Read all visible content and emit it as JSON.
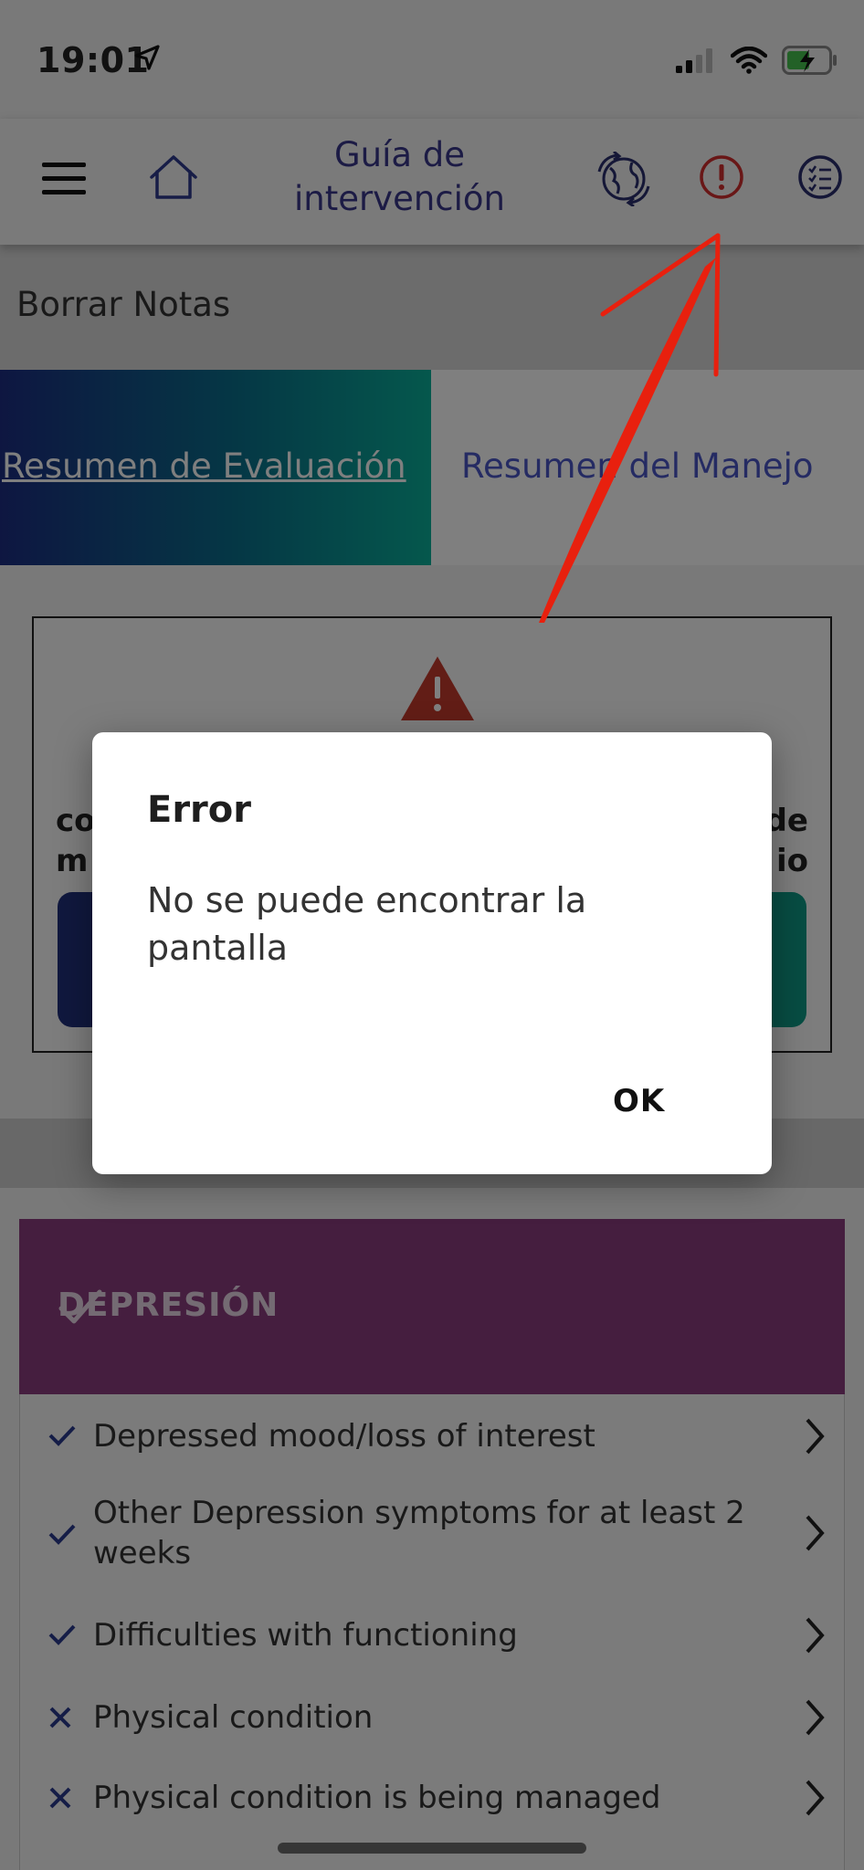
{
  "status_bar": {
    "time": "19:01",
    "icons": [
      "location-arrow-icon",
      "signal-icon",
      "wifi-icon",
      "battery-charging-icon"
    ]
  },
  "nav": {
    "title": "Guía de intervención",
    "icons": [
      "menu-icon",
      "home-icon",
      "sync-globe-icon",
      "alert-icon",
      "checklist-icon"
    ]
  },
  "borrar_notas": "Borrar Notas",
  "tabs": [
    {
      "label": "Resumen de Evaluación",
      "active": true
    },
    {
      "label": "Resumen del Manejo",
      "active": false
    }
  ],
  "alert_box": {
    "left_text": "co\nm",
    "right_text": "de\nio"
  },
  "depression_card": {
    "title": "DEPRESIÓN",
    "completed": true
  },
  "depression_items": [
    {
      "label": "Depressed mood/loss of interest",
      "status": "check"
    },
    {
      "label": "Other Depression symptoms for at least 2 weeks",
      "status": "check"
    },
    {
      "label": "Difficulties with functioning",
      "status": "check"
    },
    {
      "label": "Physical condition",
      "status": "cross"
    },
    {
      "label": "Physical condition is being managed",
      "status": "cross"
    }
  ],
  "dialog": {
    "title": "Error",
    "message": "No se puede encontrar la pantalla",
    "ok_label": "OK"
  },
  "colors": {
    "nav_text": "#39378b",
    "alert_red": "#d32f2f",
    "depression": "#8b3d7e",
    "annotation_red": "#e8200e"
  }
}
